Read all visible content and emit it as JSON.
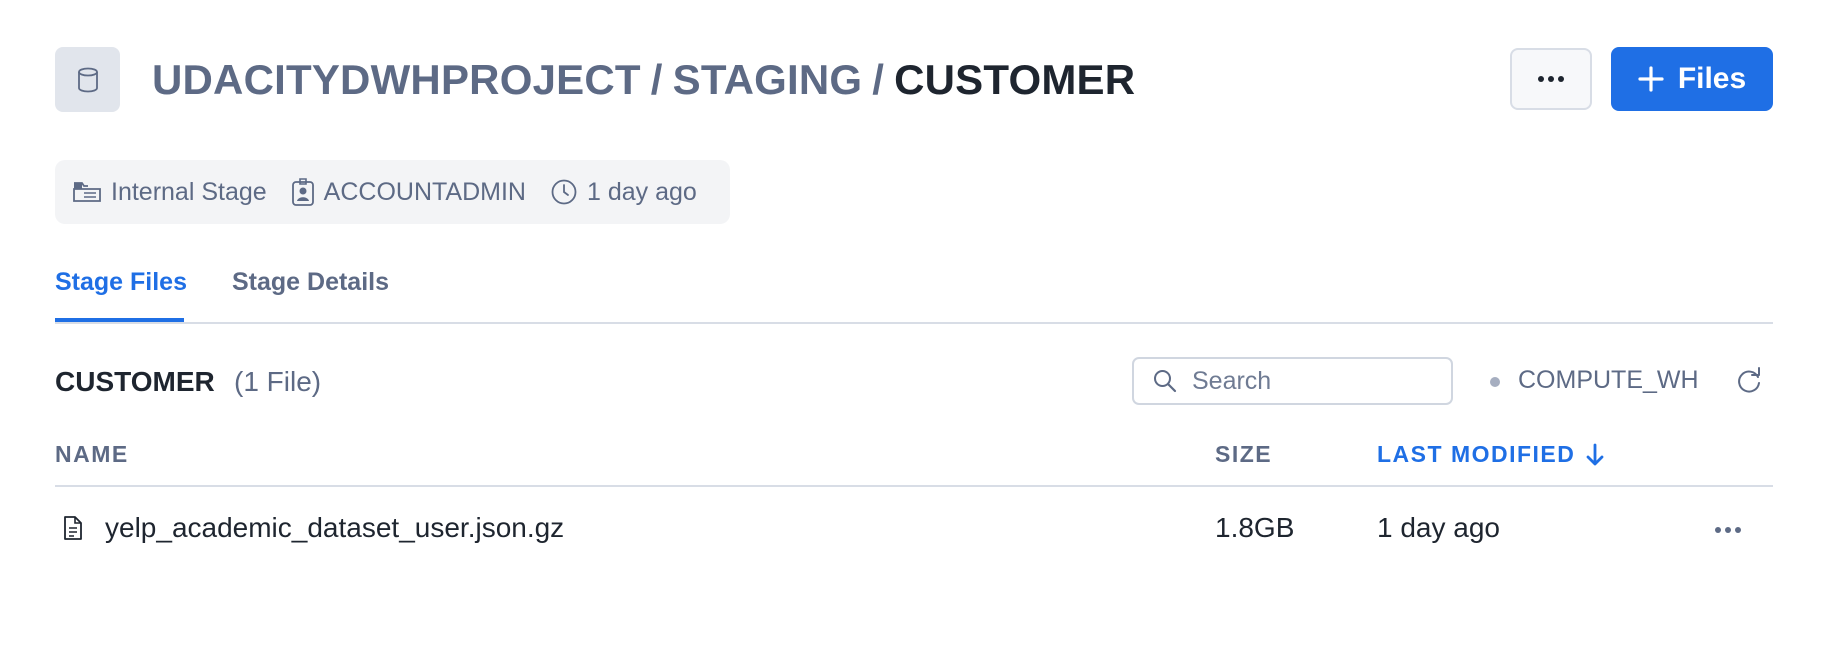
{
  "header": {
    "breadcrumb": [
      "UDACITYDWHPROJECT",
      "STAGING",
      "CUSTOMER"
    ],
    "separator": "/",
    "files_button_label": "Files"
  },
  "meta": {
    "stage_type": "Internal Stage",
    "owner": "ACCOUNTADMIN",
    "modified": "1 day ago"
  },
  "tabs": [
    {
      "label": "Stage Files",
      "active": true
    },
    {
      "label": "Stage Details",
      "active": false
    }
  ],
  "section": {
    "title": "CUSTOMER",
    "count": "(1 File)"
  },
  "search": {
    "placeholder": "Search",
    "value": ""
  },
  "warehouse": "COMPUTE_WH",
  "table": {
    "columns": [
      "NAME",
      "SIZE",
      "LAST MODIFIED"
    ],
    "sort": {
      "column": "LAST MODIFIED",
      "direction": "desc"
    },
    "rows": [
      {
        "name": "yelp_academic_dataset_user.json.gz",
        "size": "1.8GB",
        "last_modified": "1 day ago"
      }
    ]
  },
  "colors": {
    "accent": "#1f6fe5",
    "muted": "#5d6a85",
    "text": "#1e252f"
  },
  "icons": [
    "database-icon",
    "ellipsis-icon",
    "plus-icon",
    "stage-folder-icon",
    "user-badge-icon",
    "clock-icon",
    "search-icon",
    "refresh-icon",
    "arrow-down-icon",
    "file-icon"
  ]
}
